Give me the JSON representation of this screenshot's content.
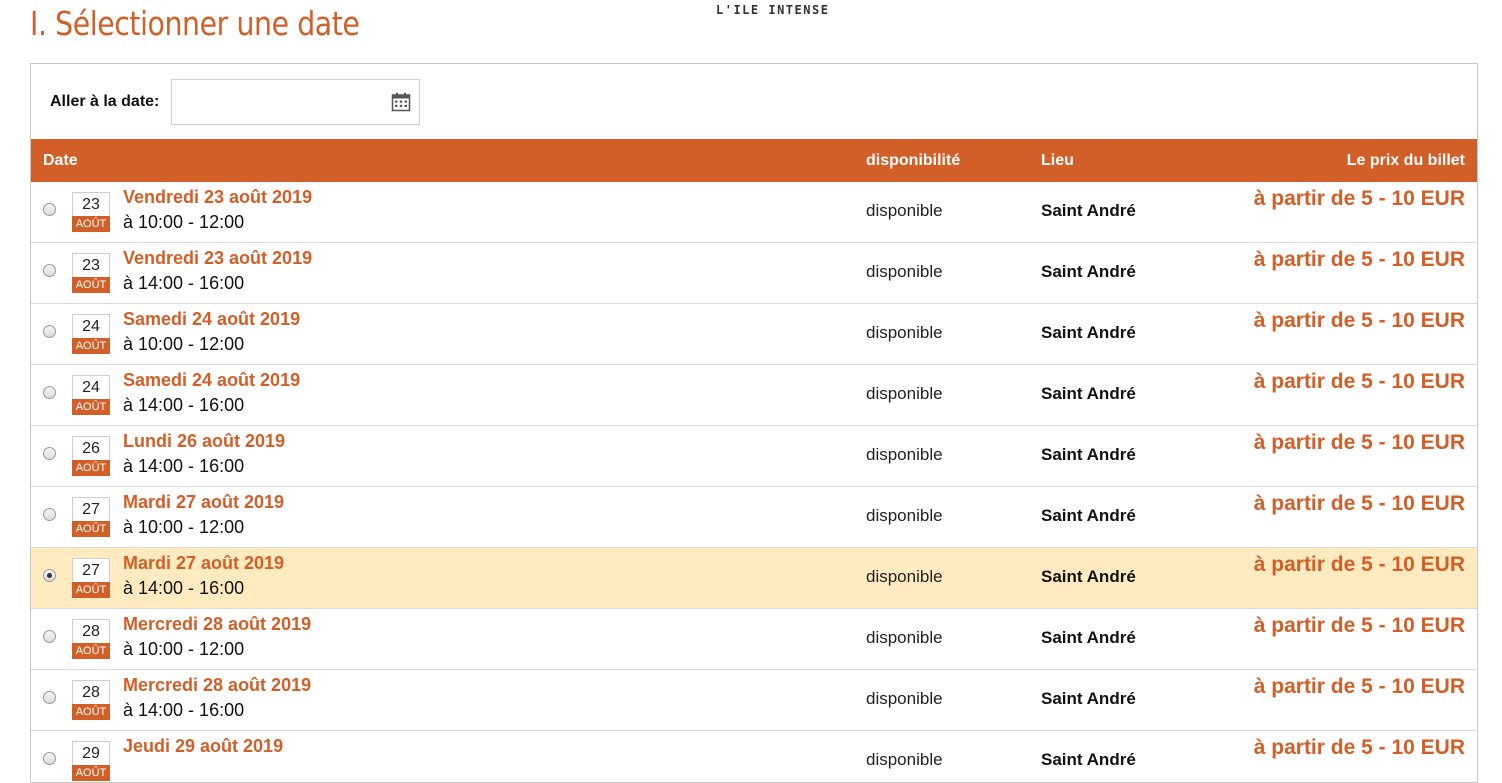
{
  "logo": "L'ILE INTENSE",
  "page": {
    "title": "I. Sélectionner une date"
  },
  "goto": {
    "label": "Aller à la date:",
    "value": "",
    "placeholder": ""
  },
  "colors": {
    "accent": "#d35f28",
    "selected_row": "#ffebbf"
  },
  "icons": {
    "calendar": "calendar-icon"
  },
  "table": {
    "headers": {
      "date": "Date",
      "availability": "disponibilité",
      "location": "Lieu",
      "price": "Le prix du billet"
    },
    "rows": [
      {
        "day": "23",
        "month": "AOÛT",
        "title": "Vendredi 23 août 2019",
        "time": "à 10:00 - 12:00",
        "availability": "disponible",
        "location": "Saint André",
        "price": "à partir de 5 - 10 EUR",
        "selected": false
      },
      {
        "day": "23",
        "month": "AOÛT",
        "title": "Vendredi 23 août 2019",
        "time": "à 14:00 - 16:00",
        "availability": "disponible",
        "location": "Saint André",
        "price": "à partir de 5 - 10 EUR",
        "selected": false
      },
      {
        "day": "24",
        "month": "AOÛT",
        "title": "Samedi 24 août 2019",
        "time": "à 10:00 - 12:00",
        "availability": "disponible",
        "location": "Saint André",
        "price": "à partir de 5 - 10 EUR",
        "selected": false
      },
      {
        "day": "24",
        "month": "AOÛT",
        "title": "Samedi 24 août 2019",
        "time": "à 14:00 - 16:00",
        "availability": "disponible",
        "location": "Saint André",
        "price": "à partir de 5 - 10 EUR",
        "selected": false
      },
      {
        "day": "26",
        "month": "AOÛT",
        "title": "Lundi 26 août 2019",
        "time": "à 14:00 - 16:00",
        "availability": "disponible",
        "location": "Saint André",
        "price": "à partir de 5 - 10 EUR",
        "selected": false
      },
      {
        "day": "27",
        "month": "AOÛT",
        "title": "Mardi 27 août 2019",
        "time": "à 10:00 - 12:00",
        "availability": "disponible",
        "location": "Saint André",
        "price": "à partir de 5 - 10 EUR",
        "selected": false
      },
      {
        "day": "27",
        "month": "AOÛT",
        "title": "Mardi 27 août 2019",
        "time": "à 14:00 - 16:00",
        "availability": "disponible",
        "location": "Saint André",
        "price": "à partir de 5 - 10 EUR",
        "selected": true
      },
      {
        "day": "28",
        "month": "AOÛT",
        "title": "Mercredi 28 août 2019",
        "time": "à 10:00 - 12:00",
        "availability": "disponible",
        "location": "Saint André",
        "price": "à partir de 5 - 10 EUR",
        "selected": false
      },
      {
        "day": "28",
        "month": "AOÛT",
        "title": "Mercredi 28 août 2019",
        "time": "à 14:00 - 16:00",
        "availability": "disponible",
        "location": "Saint André",
        "price": "à partir de 5 - 10 EUR",
        "selected": false
      },
      {
        "day": "29",
        "month": "AOÛT",
        "title": "Jeudi 29 août 2019",
        "time": "",
        "availability": "disponible",
        "location": "Saint André",
        "price": "à partir de 5 - 10 EUR",
        "selected": false
      }
    ]
  }
}
